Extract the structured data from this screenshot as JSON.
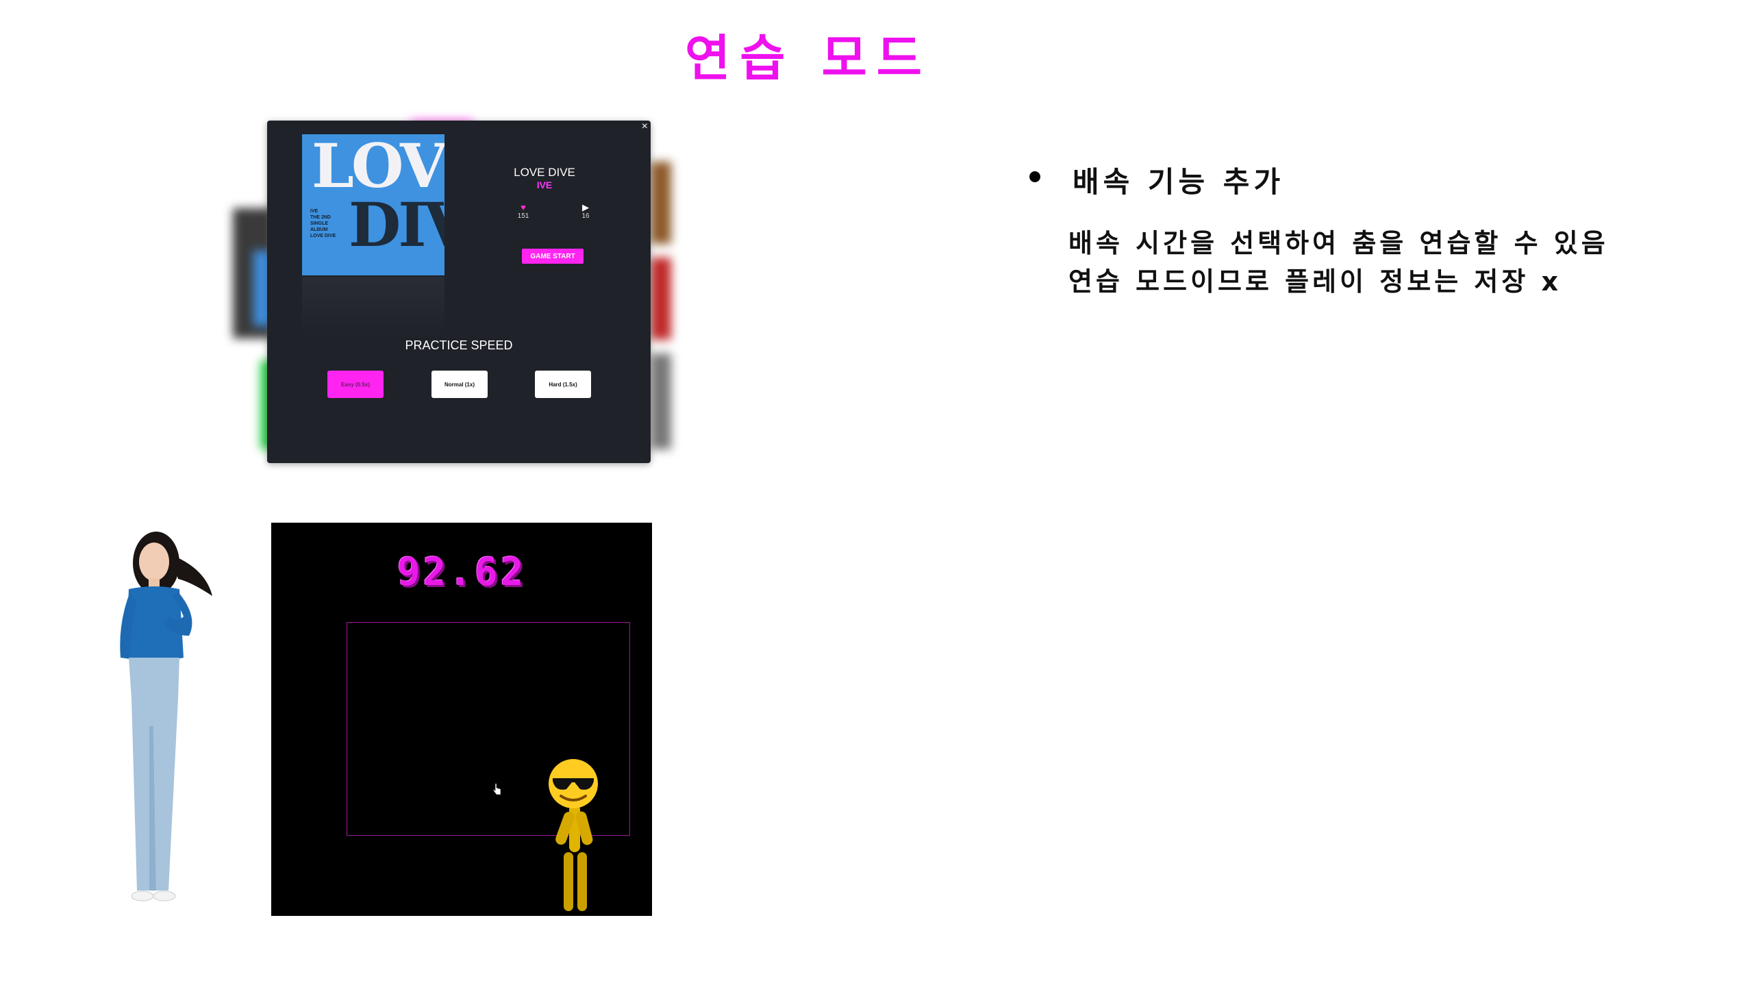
{
  "slide": {
    "title": "연습 모드"
  },
  "modal": {
    "close_label": "×",
    "album_art": {
      "big_text_1": "LOVE",
      "big_text_2": "DIVE",
      "small_text": "IVE\nTHE 2ND\nSINGLE\nALBUM\nLOVE DIVE"
    },
    "song_title": "LOVE DIVE",
    "artist": "IVE",
    "likes": "151",
    "plays": "16",
    "start_button": "GAME START",
    "practice_title": "PRACTICE SPEED",
    "speed_options": [
      {
        "label": "Easy (0.5x)",
        "selected": true
      },
      {
        "label": "Normal (1x)",
        "selected": false
      },
      {
        "label": "Hard (1.5x)",
        "selected": false
      }
    ]
  },
  "game": {
    "score": "92.62"
  },
  "notes": {
    "heading": "배속 기능 추가",
    "lines": [
      "배속 시간을 선택하여 춤을 연습할 수 있음",
      "연습 모드이므로 플레이 정보는 저장 x"
    ]
  },
  "colors": {
    "accent": "#ee11ee",
    "modal_bg": "#1f2228",
    "album_blue": "#3e92e0",
    "game_bg": "#000000"
  }
}
